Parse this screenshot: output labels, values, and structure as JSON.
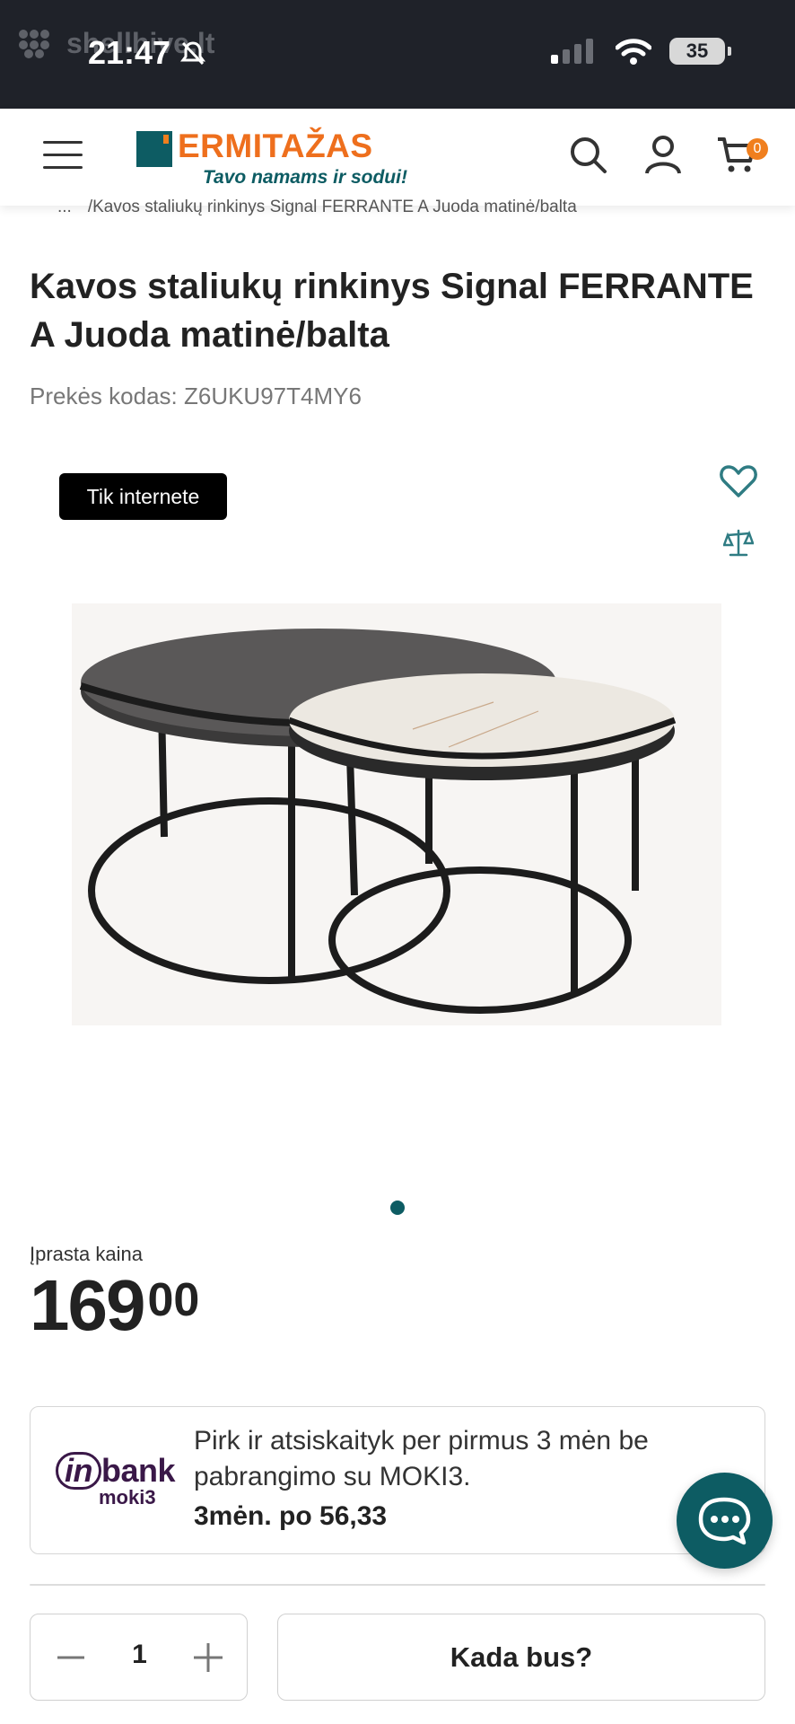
{
  "status_bar": {
    "ghost_text": "shellhive.lt",
    "time": "21:47",
    "battery": "35",
    "icons": [
      "bell-slash-icon",
      "signal-icon",
      "wifi-icon",
      "battery-icon"
    ]
  },
  "header": {
    "logo_name": "ERMITAŽAS",
    "logo_tagline": "Tavo namams ir sodui!",
    "cart_count": "0",
    "icons": [
      "menu-icon",
      "search-icon",
      "user-icon",
      "cart-icon"
    ],
    "colors": {
      "brand_teal": "#0d5c63",
      "brand_orange": "#ee6f1d"
    }
  },
  "breadcrumb": {
    "dots": "...",
    "current": "/Kavos staliukų rinkinys Signal FERRANTE A Juoda matinė/balta"
  },
  "product": {
    "title": "Kavos staliukų rinkinys Signal FERRANTE A Juoda matinė/balta",
    "sku": "Prekės kodas: Z6UKU97T4MY6",
    "badge": "Tik internete",
    "image_alt": "Kavos staliukų rinkinys",
    "price_label": "Įprasta kaina",
    "price_main": "169",
    "price_cents": "00"
  },
  "installment": {
    "brand": "in",
    "brand_rest": "bank",
    "brand_sub": "moki3",
    "text": "Pirk ir atsiskaityk per pirmus 3 mėn be pabrangimo su MOKI3.",
    "amount": "3mėn. po 56,33"
  },
  "bottom": {
    "quantity": "1",
    "when_button": "Kada bus?"
  }
}
